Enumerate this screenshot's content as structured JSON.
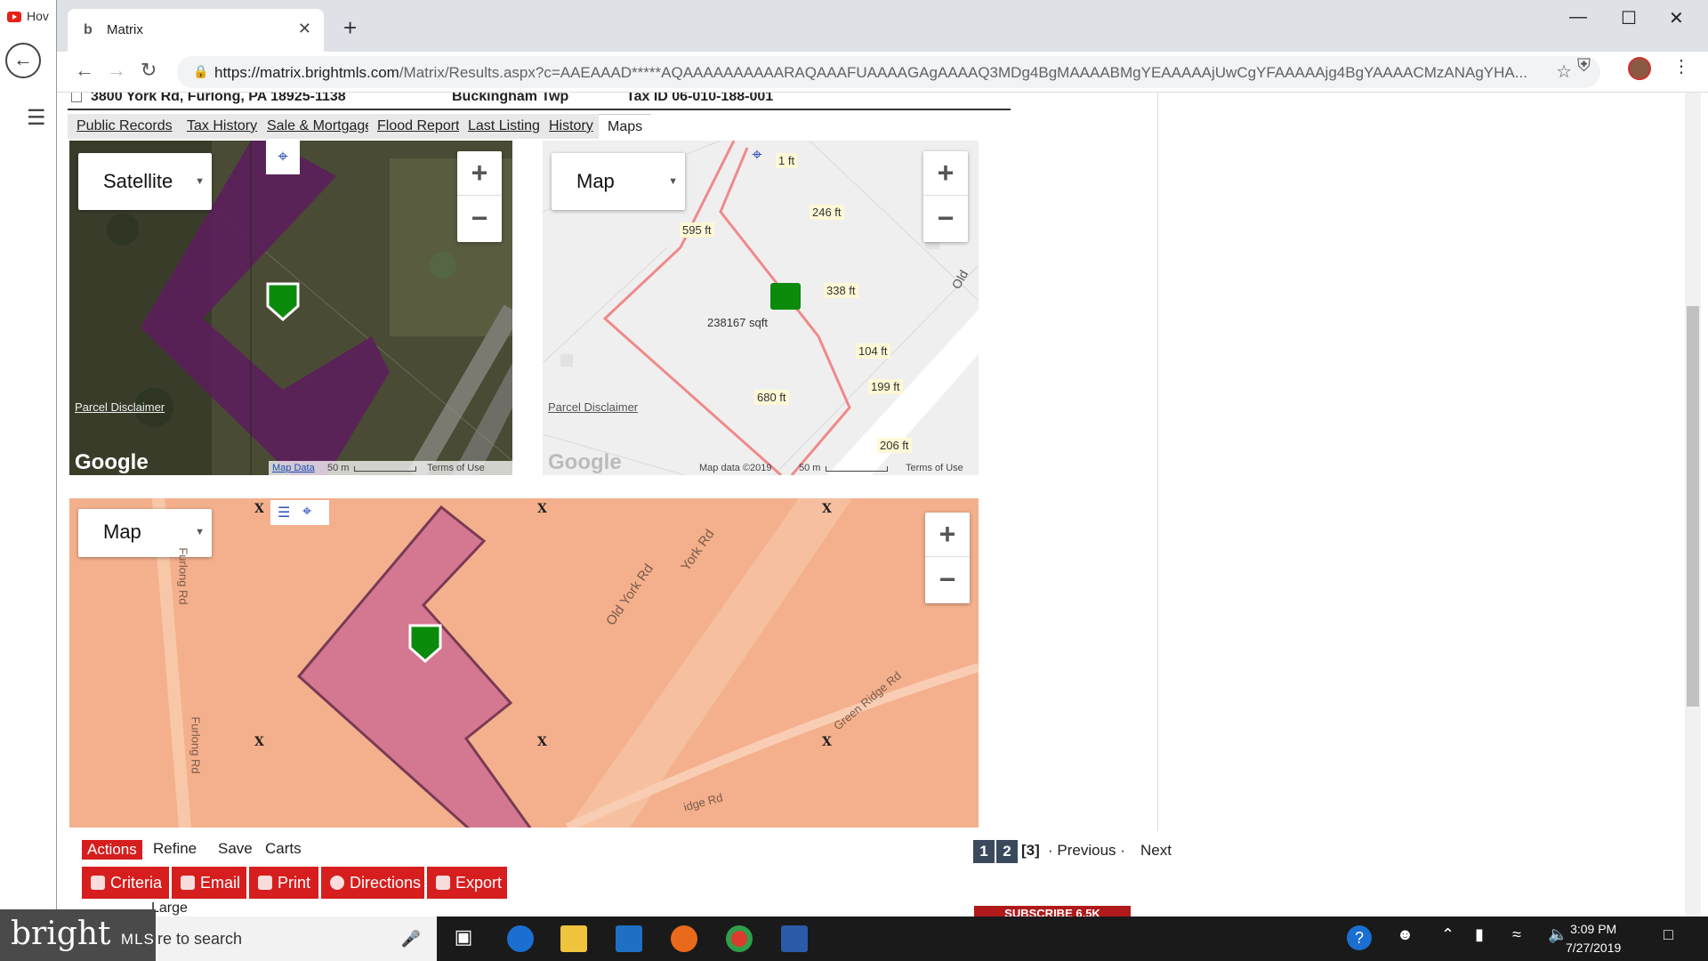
{
  "background": {
    "tab_text": "Hov"
  },
  "browser": {
    "tab_title": "Matrix",
    "url_host": "https://matrix.brightmls.com",
    "url_rest": "/Matrix/Results.aspx?c=AAEAAAD*****AQAAAAAAAAAARAQAAAFUAAAAGAgAAAAQ3MDg4BgMAAAABMgYEAAAAAjUwCgYFAAAAAjg4BgYAAAACMzANAgYHA..."
  },
  "listing": {
    "address": "3800 York Rd, Furlong, PA 18925-1138",
    "township": "Buckingham Twp",
    "tax_id": "Tax ID 06-010-188-001"
  },
  "tabs": [
    {
      "label": "Public Records"
    },
    {
      "label": "Tax History"
    },
    {
      "label": "Sale & Mortgage"
    },
    {
      "label": "Flood Report"
    },
    {
      "label": "Last Listing"
    },
    {
      "label": "History"
    },
    {
      "label": "Maps"
    }
  ],
  "maps": {
    "satellite": {
      "type_label": "Satellite",
      "disclaimer": "Parcel Disclaimer",
      "google": "Google",
      "map_data": "Map Data",
      "scale": "50 m",
      "terms": "Terms of Use"
    },
    "parcel": {
      "type_label": "Map",
      "disclaimer": "Parcel Disclaimer",
      "google": "Google",
      "map_data": "Map data ©2019",
      "scale": "50 m",
      "terms": "Terms of Use",
      "measurements": [
        "1 ft",
        "246 ft",
        "595 ft",
        "338 ft",
        "238167 sqft",
        "104 ft",
        "199 ft",
        "680 ft",
        "206 ft"
      ],
      "road_label": "Old"
    },
    "flood": {
      "type_label": "Map",
      "x_marker": "X",
      "roads": [
        "Furlong Rd",
        "Furlong Rd",
        "Old York Rd",
        "York Rd",
        "Green Ridge Rd",
        "idge Rd"
      ]
    }
  },
  "actions": {
    "label": "Actions",
    "links": [
      "Refine",
      "Save",
      "Carts"
    ],
    "buttons": [
      "Criteria",
      "Email",
      "Print",
      "Directions",
      "Export"
    ]
  },
  "pager": {
    "pages": [
      "1",
      "2"
    ],
    "current": "[3]",
    "previous": "· Previous ·",
    "next": "Next"
  },
  "overlay": {
    "brand": "bright",
    "brand_suffix": "MLS",
    "subscribe": "SUBSCRIBE 6.5K",
    "obscured_label": "Large"
  },
  "taskbar": {
    "search_text": "re to search",
    "time": "3:09 PM",
    "date": "7/27/2019"
  },
  "colors": {
    "parcel_purple": "#5a1f5a",
    "flood_orange": "#f4b08c",
    "parcel_pink": "#d47891",
    "pin_green": "#0c8a0c",
    "accent_red": "#d61e1e"
  }
}
